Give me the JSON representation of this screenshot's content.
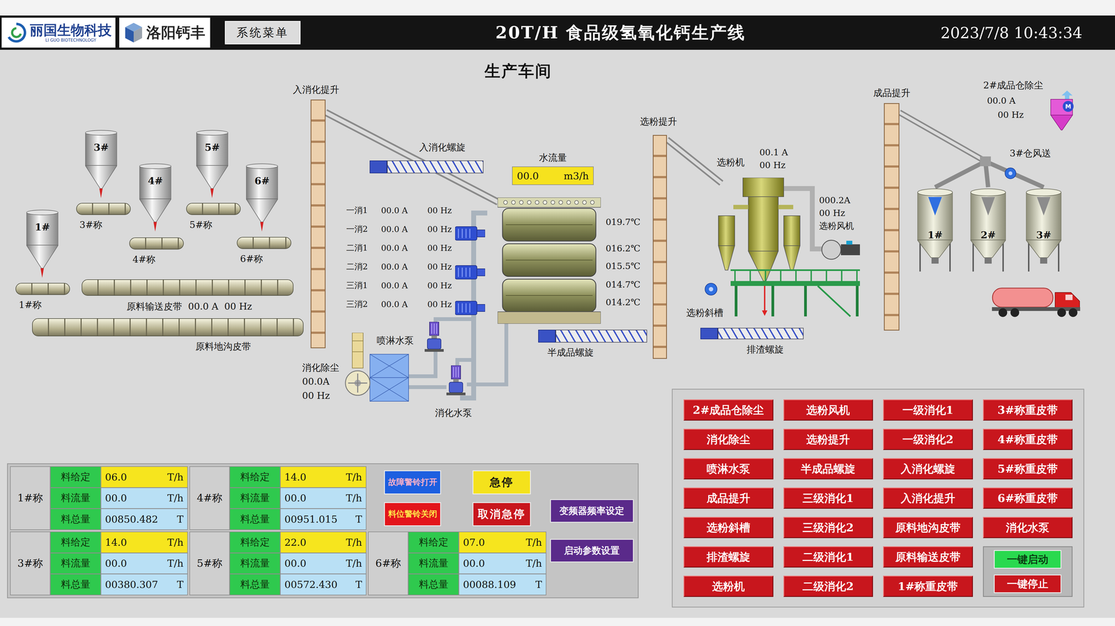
{
  "header": {
    "brand": {
      "name": "丽国生物科技",
      "subtitle": "LI GUO BIOTECHNOLOGY"
    },
    "partner": "洛阳钙丰",
    "menu_button": "系统菜单",
    "title": "20T/H 食品级氢氧化钙生产线",
    "datetime": "2023/7/8 10:43:34"
  },
  "workshop_title": "生产车间",
  "raw_silos": [
    {
      "label": "1#"
    },
    {
      "label": "3#"
    },
    {
      "label": "4#"
    },
    {
      "label": "5#"
    },
    {
      "label": "6#"
    }
  ],
  "weigh_belts": [
    {
      "label": "1#称"
    },
    {
      "label": "3#称"
    },
    {
      "label": "4#称"
    },
    {
      "label": "5#称"
    },
    {
      "label": "6#称"
    }
  ],
  "raw_conveyor": {
    "name": "原料输送皮带",
    "current": "00.0 A",
    "freq": "00 Hz"
  },
  "ground_conveyor": {
    "name": "原料地沟皮带"
  },
  "feed_elevator": {
    "name": "入消化提升"
  },
  "feed_screw": {
    "name": "入消化螺旋"
  },
  "water_flow": {
    "label": "水流量",
    "value": "00.0",
    "unit": "m3/h"
  },
  "digester_motors": [
    {
      "name": "一消1",
      "current": "00.0 A",
      "freq": "00 Hz"
    },
    {
      "name": "一消2",
      "current": "00.0 A",
      "freq": "00 Hz"
    },
    {
      "name": "二消1",
      "current": "00.0 A",
      "freq": "00 Hz"
    },
    {
      "name": "二消2",
      "current": "00.0 A",
      "freq": "00 Hz"
    },
    {
      "name": "三消1",
      "current": "00.0 A",
      "freq": "00 Hz"
    },
    {
      "name": "三消2",
      "current": "00.0 A",
      "freq": "00 Hz"
    }
  ],
  "temperatures": [
    "019.7℃",
    "016.2℃",
    "015.5℃",
    "014.7℃",
    "014.2℃"
  ],
  "spray_pump": {
    "name": "喷淋水泵"
  },
  "digest_pump": {
    "name": "消化水泵"
  },
  "digest_dust": {
    "name": "消化除尘",
    "current": "00.0A",
    "freq": "00 Hz"
  },
  "semi_screw": {
    "name": "半成品螺旋"
  },
  "classifier_elevator": {
    "name": "选粉提升"
  },
  "classifier": {
    "name": "选粉机",
    "current": "00.1 A",
    "freq": "00 Hz"
  },
  "classifier_fan": {
    "name": "选粉风机",
    "current": "000.2A",
    "freq": "00 Hz"
  },
  "classifier_chute": {
    "name": "选粉斜槽"
  },
  "slag_screw": {
    "name": "排渣螺旋"
  },
  "product_elevator": {
    "name": "成品提升"
  },
  "product_dust": {
    "name": "2#成品仓除尘",
    "current": "00.0 A",
    "freq": "00 Hz",
    "motor_label": "M"
  },
  "silo3_blower": {
    "name": "3#仓风送"
  },
  "product_silos": [
    {
      "label": "1#",
      "color": "#2f6fe0"
    },
    {
      "label": "2#",
      "color": "#8c8c8c"
    },
    {
      "label": "3#",
      "color": "#8c8c8c"
    }
  ],
  "scales": [
    {
      "name": "1#称",
      "rows": [
        {
          "label": "料给定",
          "value": "06.0",
          "unit": "T/h",
          "kind": "setpoint"
        },
        {
          "label": "料流量",
          "value": "00.0",
          "unit": "T/h",
          "kind": "reading"
        },
        {
          "label": "料总量",
          "value": "00850.482",
          "unit": "T",
          "kind": "reading"
        }
      ]
    },
    {
      "name": "4#称",
      "rows": [
        {
          "label": "料给定",
          "value": "14.0",
          "unit": "T/h",
          "kind": "setpoint"
        },
        {
          "label": "料流量",
          "value": "00.0",
          "unit": "T/h",
          "kind": "reading"
        },
        {
          "label": "料总量",
          "value": "00951.015",
          "unit": "T",
          "kind": "reading"
        }
      ]
    },
    {
      "name": "3#称",
      "rows": [
        {
          "label": "料给定",
          "value": "14.0",
          "unit": "T/h",
          "kind": "setpoint"
        },
        {
          "label": "料流量",
          "value": "00.0",
          "unit": "T/h",
          "kind": "reading"
        },
        {
          "label": "料总量",
          "value": "00380.307",
          "unit": "T",
          "kind": "reading"
        }
      ]
    },
    {
      "name": "5#称",
      "rows": [
        {
          "label": "料给定",
          "value": "22.0",
          "unit": "T/h",
          "kind": "setpoint"
        },
        {
          "label": "料流量",
          "value": "00.0",
          "unit": "T/h",
          "kind": "reading"
        },
        {
          "label": "料总量",
          "value": "00572.430",
          "unit": "T",
          "kind": "reading"
        }
      ]
    },
    {
      "name": "6#称",
      "rows": [
        {
          "label": "料给定",
          "value": "07.0",
          "unit": "T/h",
          "kind": "setpoint"
        },
        {
          "label": "料流量",
          "value": "00.0",
          "unit": "T/h",
          "kind": "reading"
        },
        {
          "label": "料总量",
          "value": "00088.109",
          "unit": "T",
          "kind": "reading"
        }
      ]
    }
  ],
  "alarm_buttons": [
    {
      "label": "故障警铃打开",
      "color": "#1d5fe0"
    },
    {
      "label": "料位警铃关闭",
      "color": "#e3151b"
    }
  ],
  "estop_buttons": [
    {
      "label": "急停",
      "color": "#f4e21c"
    },
    {
      "label": "取消急停",
      "color": "#c8161d"
    }
  ],
  "settings_buttons": [
    "变频器频率设定",
    "启动参数设置"
  ],
  "motor_buttons": [
    {
      "label": "2#成品仓除尘",
      "running": false
    },
    {
      "label": "消化除尘",
      "running": false
    },
    {
      "label": "喷淋水泵",
      "running": false
    },
    {
      "label": "成品提升",
      "running": false
    },
    {
      "label": "选粉斜槽",
      "running": false
    },
    {
      "label": "排渣螺旋",
      "running": false
    },
    {
      "label": "选粉机",
      "running": false
    },
    {
      "label": "选粉风机",
      "running": false
    },
    {
      "label": "选粉提升",
      "running": false
    },
    {
      "label": "半成品螺旋",
      "running": false
    },
    {
      "label": "三级消化1",
      "running": false
    },
    {
      "label": "三级消化2",
      "running": false
    },
    {
      "label": "二级消化1",
      "running": false
    },
    {
      "label": "二级消化2",
      "running": false
    },
    {
      "label": "一级消化1",
      "running": false
    },
    {
      "label": "一级消化2",
      "running": false
    },
    {
      "label": "入消化螺旋",
      "running": false
    },
    {
      "label": "入消化提升",
      "running": false
    },
    {
      "label": "原料地沟皮带",
      "running": false
    },
    {
      "label": "原料输送皮带",
      "running": false
    },
    {
      "label": "1#称重皮带",
      "running": false
    },
    {
      "label": "3#称重皮带",
      "running": false
    },
    {
      "label": "4#称重皮带",
      "running": false
    },
    {
      "label": "5#称重皮带",
      "running": false
    },
    {
      "label": "6#称重皮带",
      "running": false
    },
    {
      "label": "消化水泵",
      "running": false
    }
  ],
  "one_key_buttons": [
    {
      "label": "一键启动",
      "kind": "start"
    },
    {
      "label": "一键停止",
      "kind": "stop"
    }
  ]
}
